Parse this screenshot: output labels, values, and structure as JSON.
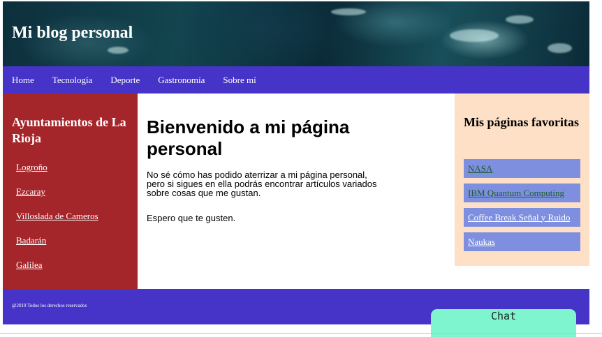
{
  "header": {
    "title": "Mi blog personal"
  },
  "nav": [
    {
      "label": "Home"
    },
    {
      "label": "Tecnología"
    },
    {
      "label": "Deporte"
    },
    {
      "label": "Gastronomía"
    },
    {
      "label": "Sobre mí"
    }
  ],
  "left": {
    "title": "Ayuntamientos de La Rioja",
    "links": [
      {
        "label": "Logroño"
      },
      {
        "label": "Ezcaray"
      },
      {
        "label": "Villoslada de Cameros"
      },
      {
        "label": "Badarán"
      },
      {
        "label": "Galilea"
      }
    ]
  },
  "main": {
    "heading": "Bienvenido a mi página personal",
    "paragraph1": "No sé cómo has podido aterrizar a mi página personal, pero si sigues en ella podrás encontrar artículos variados sobre cosas que me gustan.",
    "paragraph2": "Espero que te gusten."
  },
  "right": {
    "title": "Mis páginas favoritas",
    "links": [
      {
        "label": "NASA",
        "color": "#1a5e2a"
      },
      {
        "label": "IBM Quantum Computing",
        "color": "#1a5e2a"
      },
      {
        "label": "Coffee Break Señal y Ruido",
        "color": "#ffffff"
      },
      {
        "label": "Naukas",
        "color": "#ffffff"
      }
    ]
  },
  "footer": {
    "copyright": "@2019 Todos los derechos reservados"
  },
  "chat": {
    "label": "Chat"
  },
  "colors": {
    "nav": "#4634c8",
    "left_panel": "#a4252a",
    "right_panel": "#fde0c5",
    "fav_link_bg": "#7e8fe0",
    "chat": "#7ff5cf"
  }
}
